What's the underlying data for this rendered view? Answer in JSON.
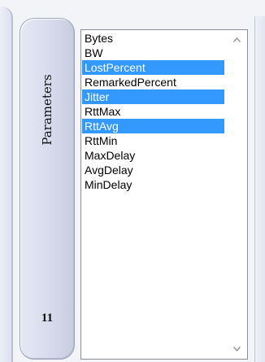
{
  "tab": {
    "label": "Parameters",
    "count": "11"
  },
  "listbox": {
    "items": [
      {
        "label": "Bytes",
        "selected": false
      },
      {
        "label": "BW",
        "selected": false
      },
      {
        "label": "LostPercent",
        "selected": true
      },
      {
        "label": "RemarkedPercent",
        "selected": false
      },
      {
        "label": "Jitter",
        "selected": true
      },
      {
        "label": "RttMax",
        "selected": false
      },
      {
        "label": "RttAvg",
        "selected": true
      },
      {
        "label": "RttMin",
        "selected": false
      },
      {
        "label": "MaxDelay",
        "selected": false
      },
      {
        "label": "AvgDelay",
        "selected": false
      },
      {
        "label": "MinDelay",
        "selected": false
      }
    ]
  },
  "colors": {
    "selection": "#3399ff",
    "tab_border": "#9ea3bf"
  },
  "icons": {
    "scroll_up": "scroll-up-arrow-icon",
    "scroll_down": "scroll-down-arrow-icon"
  }
}
